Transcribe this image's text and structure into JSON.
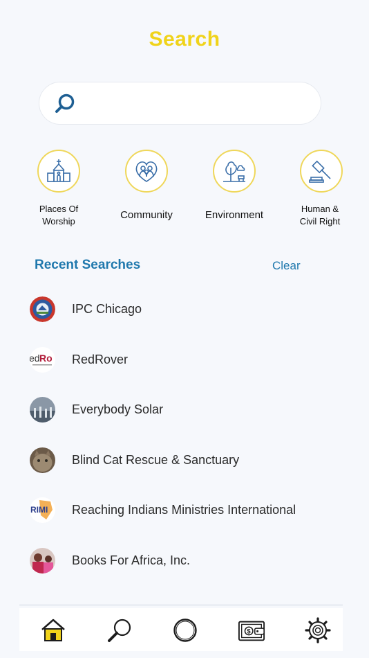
{
  "header": {
    "title": "Search"
  },
  "search": {
    "placeholder": "",
    "value": ""
  },
  "categories": [
    {
      "label": "Places Of Worship",
      "icon": "church-icon"
    },
    {
      "label": "Community",
      "icon": "community-icon"
    },
    {
      "label": "Environment",
      "icon": "environment-icon"
    },
    {
      "label": "Human & Civil Right",
      "icon": "gavel-icon"
    }
  ],
  "recent": {
    "heading": "Recent Searches",
    "clear_label": "Clear",
    "items": [
      {
        "name": "IPC Chicago"
      },
      {
        "name": "RedRover",
        "avatar_text": "edRo"
      },
      {
        "name": "Everybody Solar"
      },
      {
        "name": "Blind Cat Rescue & Sanctuary"
      },
      {
        "name": "Reaching Indians Ministries International",
        "avatar_text": "RIMI"
      },
      {
        "name": "Books For Africa, Inc."
      }
    ]
  },
  "nav": {
    "items": [
      {
        "icon": "home-icon",
        "active": true
      },
      {
        "icon": "search-icon"
      },
      {
        "icon": "circle-icon"
      },
      {
        "icon": "wallet-icon"
      },
      {
        "icon": "settings-gear-icon"
      }
    ]
  },
  "colors": {
    "title": "#f0d31a",
    "accent": "#1f78ad",
    "category_ring": "#efd75a",
    "background": "#f6f8fc"
  }
}
